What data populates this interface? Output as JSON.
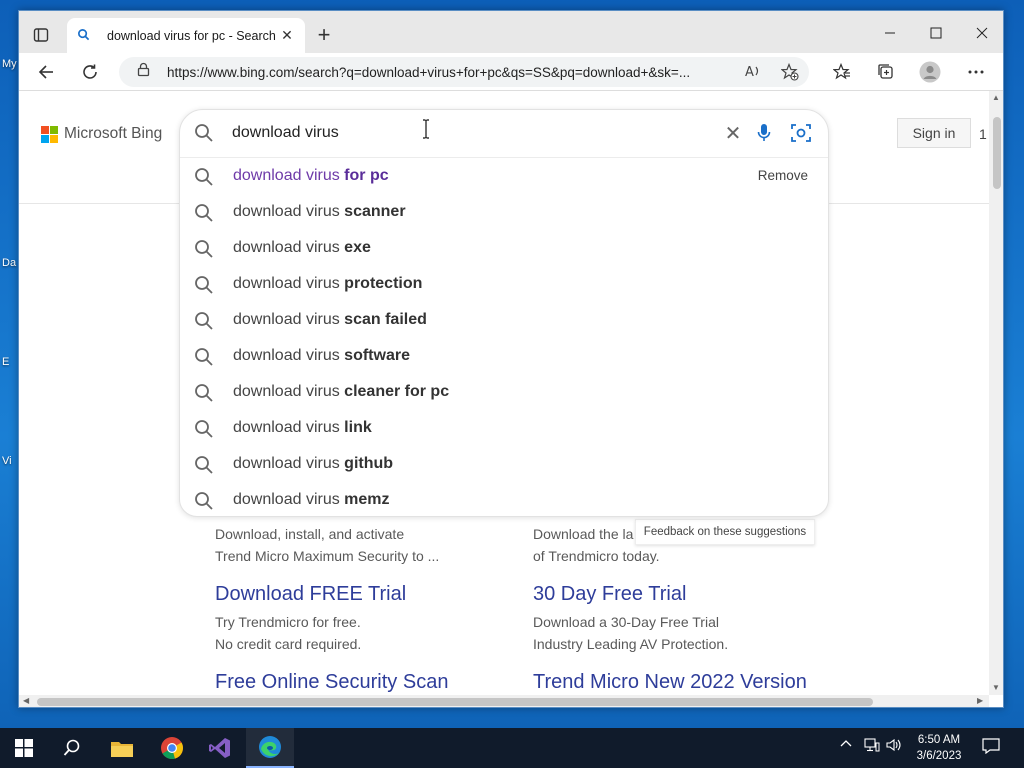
{
  "desktop": {
    "icons": [
      "My",
      "Da",
      "E",
      "Vi"
    ]
  },
  "browser": {
    "tab": {
      "title": "download virus for pc - Search",
      "favicon": "search-icon"
    },
    "window_controls": [
      "minimize",
      "maximize",
      "close"
    ],
    "address": {
      "url": "https://www.bing.com/search?q=download+virus+for+pc&qs=SS&pq=download+&sk=..."
    }
  },
  "page": {
    "brand": "Microsoft Bing",
    "sign_in": "Sign in",
    "rewards_count": "1",
    "search": {
      "query": "download virus",
      "remove_label": "Remove",
      "suggestions": [
        {
          "prefix": "download virus ",
          "bold": "for pc"
        },
        {
          "prefix": "download virus ",
          "bold": "scanner"
        },
        {
          "prefix": "download virus ",
          "bold": "exe"
        },
        {
          "prefix": "download virus ",
          "bold": "protection"
        },
        {
          "prefix": "download virus ",
          "bold": "scan failed"
        },
        {
          "prefix": "download virus ",
          "bold": "software"
        },
        {
          "prefix": "download virus ",
          "bold": "cleaner for pc"
        },
        {
          "prefix": "download virus ",
          "bold": "link"
        },
        {
          "prefix": "download virus ",
          "bold": "github"
        },
        {
          "prefix": "download virus ",
          "bold": "memz"
        }
      ],
      "feedback": "Feedback on these suggestions"
    },
    "results": {
      "left": {
        "snippet_top_1": "Download, install, and activate",
        "snippet_top_2": "Trend Micro Maximum Security to ...",
        "title": "Download FREE Trial",
        "snippet_1": "Try Trendmicro for free.",
        "snippet_2": "No credit card required.",
        "bottom_title": "Free Online Security Scan"
      },
      "right": {
        "snippet_top_1": "Download the la",
        "snippet_top_2": "of Trendmicro today.",
        "title": "30 Day Free Trial",
        "snippet_1": "Download a 30-Day Free Trial",
        "snippet_2": "Industry Leading AV Protection.",
        "bottom_title": "Trend Micro New 2022 Version"
      }
    }
  },
  "taskbar": {
    "apps": [
      "start-icon",
      "search-icon",
      "file-explorer-icon",
      "chrome-icon",
      "visual-studio-icon",
      "edge-icon"
    ],
    "clock": {
      "time": "6:50 AM",
      "date": "3/6/2023"
    }
  },
  "colors": {
    "visited_link": "#6e3aa8",
    "result_link": "#2e3d9a",
    "taskbar": "#101b2b"
  }
}
